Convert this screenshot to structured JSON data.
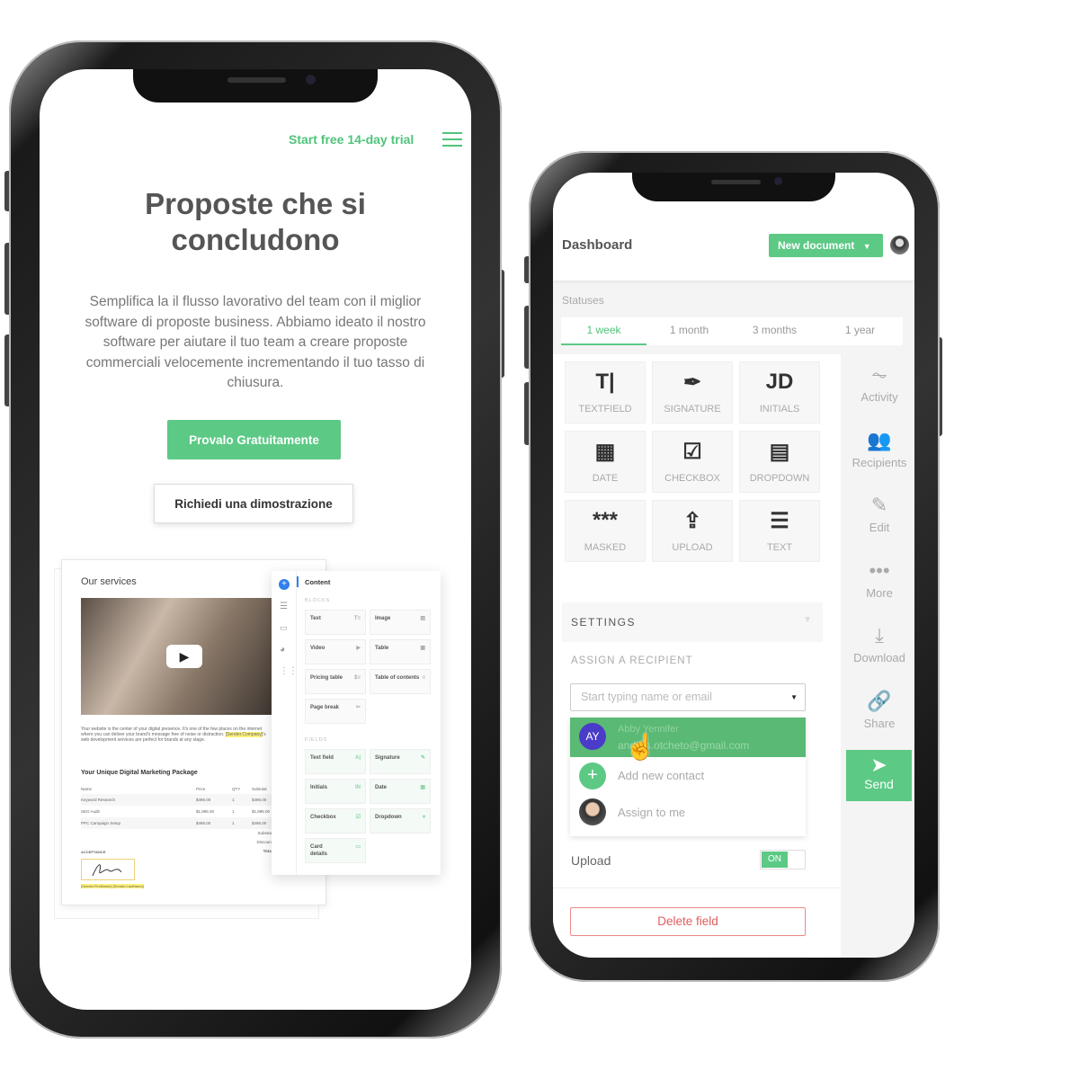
{
  "left_phone": {
    "header": {
      "trial_link": "Start free 14-day trial",
      "menu_icon": "hamburger-icon"
    },
    "hero": {
      "title": "Proposte che si concludono",
      "subtitle": "Semplifica la il flusso lavorativo del team con il miglior software di proposte business. Abbiamo ideato il nostro software per aiutare il tuo team a creare proposte commerciali velocemente incrementando il tuo tasso di chiusura.",
      "primary_button": "Provalo Gratuitamente",
      "secondary_button": "Richiedi una dimostrazione"
    },
    "document": {
      "heading": "Our services",
      "paragraph": "Your website is the center of your digital presence. It's one of the few places on the internet where you can deliver your brand's message free of noise or distraction.",
      "highlight": "[Sender.Company]",
      "paragraph_end": "'s web development services are perfect for brands at any stage.",
      "package_title": "Your Unique Digital Marketing Package",
      "table_headers": [
        "Name",
        "Price",
        "QTY",
        "Subtotal"
      ],
      "table_rows": [
        [
          "Keyword Research",
          "$495.00",
          "1",
          "$495.00"
        ],
        [
          "SEO Audit",
          "$1,995.00",
          "1",
          "$1,995.00"
        ],
        [
          "PPC Campaign Setup",
          "$495.00",
          "1",
          "$495.00"
        ]
      ],
      "totals": [
        "Subtotal",
        "Discount",
        "Total"
      ],
      "acceptance_label": "ACCEPTANCE",
      "signer_fields": "[Sender.FirstName] [Sender.LastName]"
    },
    "content_panel": {
      "title": "Content",
      "blocks_label": "BLOCKS",
      "blocks": [
        "Text",
        "Image",
        "Video",
        "Table",
        "Pricing table",
        "Table of contents",
        "Page break"
      ],
      "fields_label": "FIELDS",
      "fields": [
        "Text field",
        "Signature",
        "Initials",
        "Date",
        "Checkbox",
        "Dropdown",
        "Card details"
      ]
    }
  },
  "right_phone": {
    "header": {
      "title": "Dashboard",
      "new_document_button": "New document"
    },
    "statuses": {
      "label": "Statuses",
      "tabs": [
        "1 week",
        "1 month",
        "3 months",
        "1 year"
      ],
      "active_tab": "1 week"
    },
    "tiles": [
      {
        "glyph": "T|",
        "label": "TEXTFIELD",
        "icon": "text-cursor-icon"
      },
      {
        "glyph": "✒",
        "label": "SIGNATURE",
        "icon": "pen-nib-icon"
      },
      {
        "glyph": "JD",
        "label": "INITIALS",
        "icon": "initials-icon"
      },
      {
        "glyph": "▦",
        "label": "DATE",
        "icon": "calendar-icon"
      },
      {
        "glyph": "☑",
        "label": "CHECKBOX",
        "icon": "checkbox-icon"
      },
      {
        "glyph": "▤",
        "label": "DROPDOWN",
        "icon": "dropdown-icon"
      },
      {
        "glyph": "***",
        "label": "MASKED",
        "icon": "masked-icon"
      },
      {
        "glyph": "⇪",
        "label": "UPLOAD",
        "icon": "upload-icon"
      },
      {
        "glyph": "☰",
        "label": "TEXT",
        "icon": "text-lines-icon"
      }
    ],
    "sidebar": [
      {
        "glyph": "⏦",
        "label": "Activity",
        "icon": "activity-icon"
      },
      {
        "glyph": "👥",
        "label": "Recipients",
        "icon": "recipients-icon"
      },
      {
        "glyph": "✎",
        "label": "Edit",
        "icon": "edit-icon"
      },
      {
        "glyph": "•••",
        "label": "More",
        "icon": "more-icon"
      },
      {
        "glyph": "⤓",
        "label": "Download",
        "icon": "download-icon"
      },
      {
        "glyph": "🔗",
        "label": "Share",
        "icon": "link-icon"
      }
    ],
    "send_button": "Send",
    "settings": {
      "title": "SETTINGS",
      "assign_label": "ASSIGN A RECIPIENT",
      "input_placeholder": "Start typing name or email",
      "options": [
        {
          "initials": "AY",
          "name": "Abby Yennifer",
          "email": "andres.otcheto@gmail.com"
        },
        {
          "label": "Add new contact"
        },
        {
          "label": "Assign to me"
        }
      ],
      "upload_label": "Upload",
      "upload_toggle": "ON",
      "delete_button": "Delete field"
    },
    "colors": {
      "accent": "#5cc985",
      "avatar": "#4b3bc9",
      "danger": "#e25c5c"
    }
  }
}
